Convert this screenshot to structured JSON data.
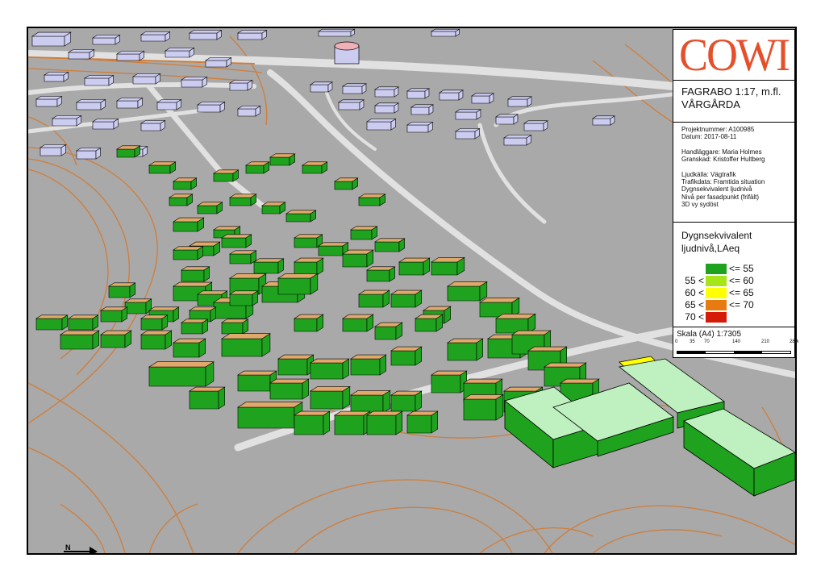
{
  "brand": {
    "logo_text": "COWI",
    "logo_color": "#e5502b"
  },
  "title": {
    "line1": "FAGRABO 1:17, m.fl.",
    "line2": "VÅRGÅRDA"
  },
  "meta": {
    "project": "Projektnummer: A100985",
    "date": "Datum: 2017-08-11",
    "handler": "Handläggare: Maria Holmes",
    "reviewer": "Granskad: Kristoffer Hultberg",
    "source": "Ljudkälla: Vägtrafik",
    "traffic": "Trafikdata: Framtida situation",
    "metric": "Dygnsekvivalent ljudnivå",
    "level_per": "Nivå per fasadpunkt (frifält)",
    "view": "3D vy sydöst"
  },
  "legend": {
    "heading1": "Dygnsekvivalent",
    "heading2": "ljudnivå,LAeq",
    "classes": [
      {
        "low": "",
        "high": "<= 55",
        "color": "#1fa31f"
      },
      {
        "low": "55 <",
        "high": "<= 60",
        "color": "#a6e619"
      },
      {
        "low": "60 <",
        "high": "<= 65",
        "color": "#ffff00"
      },
      {
        "low": "65 <",
        "high": "<= 70",
        "color": "#e87a12"
      },
      {
        "low": "70 <",
        "high": "",
        "color": "#d61a0a"
      }
    ]
  },
  "scale": {
    "label": "Skala (A4) 1:7305",
    "ticks": [
      "0",
      "35",
      "70",
      "140",
      "210",
      "280"
    ],
    "unit": "m"
  },
  "colors": {
    "ground": "#a9a9a9",
    "road": "#e1e1e1",
    "contour": "#cf7d3a",
    "roof": "#e0a86a",
    "facade_low": "#1fa31f",
    "school_roof": "#bff0bf",
    "background_building": "#ccccf0"
  },
  "map": {
    "north_arrow": "north-arrow-icon"
  }
}
